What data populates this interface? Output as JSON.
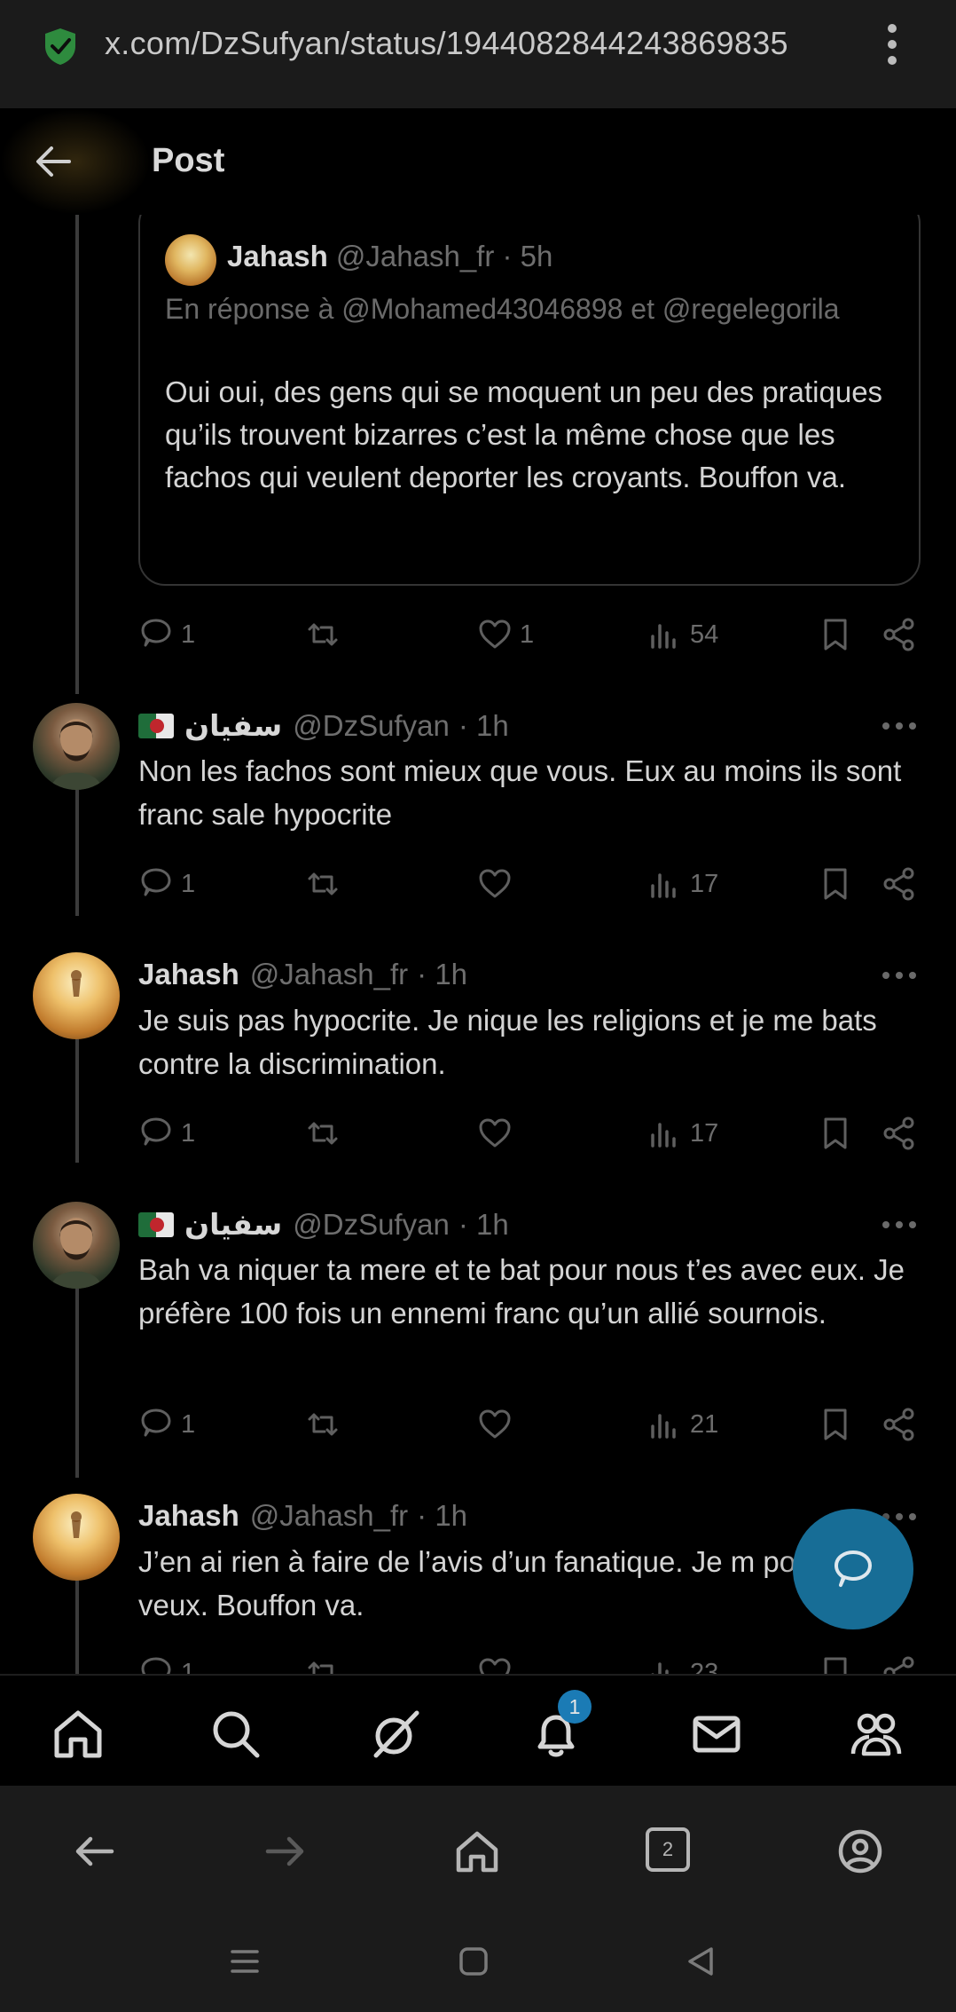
{
  "browser": {
    "url": "x.com/DzSufyan/status/1944082844243869835",
    "tab_count": "2"
  },
  "header": {
    "title": "Post"
  },
  "quoted_post": {
    "name": "Jahash",
    "handle": "@Jahash_fr",
    "time": "· 5h",
    "reply_to": "En réponse à @Mohamed43046898  et @regelegorila",
    "text": "Oui oui, des gens qui se moquent un peu des pratiques qu’ils trouvent bizarres c’est la même chose que les fachos qui veulent deporter les croyants. Bouffon va.",
    "replies": "1",
    "likes": "1",
    "views": "54"
  },
  "tweets": [
    {
      "name": "سفيان",
      "handle": "@DzSufyan",
      "time": "· 1h",
      "text": "Non les fachos sont mieux que vous. Eux au moins ils sont franc sale hypocrite",
      "replies": "1",
      "views": "17"
    },
    {
      "name": "Jahash",
      "handle": "@Jahash_fr",
      "time": "· 1h",
      "text": "Je suis pas hypocrite. Je nique les religions et je me bats contre la discrimination.",
      "replies": "1",
      "views": "17"
    },
    {
      "name": "سفيان",
      "handle": "@DzSufyan",
      "time": "· 1h",
      "text": "Bah va niquer ta mere et te bat pour nous t’es avec eux. Je préfère 100 fois un ennemi franc qu’un allié sournois.",
      "replies": "1",
      "views": "21"
    },
    {
      "name": "Jahash",
      "handle": "@Jahash_fr",
      "time": "· 1h",
      "text": "J’en ai rien à faire de l’avis d’un fanatique. Je m pour qui je veux. Bouffon va.",
      "replies": "1",
      "views": "23"
    }
  ],
  "notifications_badge": "1",
  "colors": {
    "background": "#000000",
    "fab": "#176d96",
    "badge": "#1b7bb5",
    "shield": "#2e8b3e"
  },
  "icons": [
    "shield-icon",
    "more-vert-icon",
    "back-arrow-icon",
    "reply-icon",
    "retweet-icon",
    "like-icon",
    "views-icon",
    "bookmark-icon",
    "share-icon",
    "more-horiz-icon",
    "compose-icon",
    "home-icon",
    "search-icon",
    "grok-icon",
    "bell-icon",
    "mail-icon",
    "communities-icon"
  ]
}
